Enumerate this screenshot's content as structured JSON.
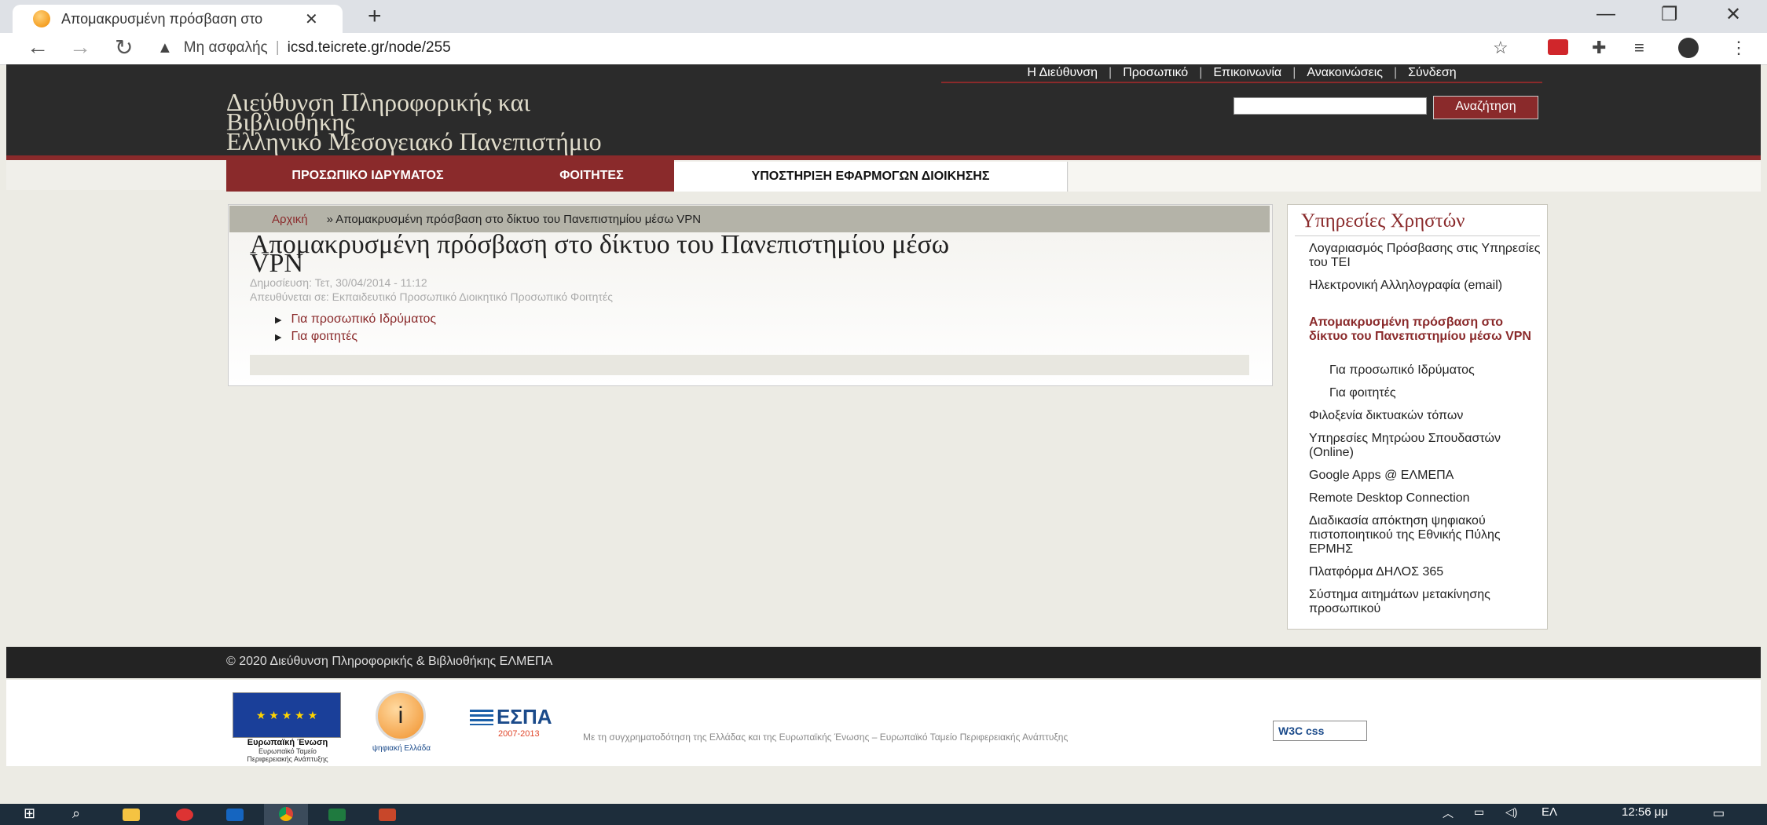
{
  "browser": {
    "tab_title": "Απομακρυσμένη πρόσβαση στο",
    "tab_close": "✕",
    "new_tab": "+",
    "not_secure": "Μη ασφαλής",
    "url": "icsd.teicrete.gr/node/255"
  },
  "site": {
    "title_lines": [
      "Διεύθυνση Πληροφορικής και",
      "Βιβλιοθήκης",
      "Ελληνικό Μεσογειακό Πανεπιστήμιο"
    ],
    "top_links": [
      "Η Διεύθυνση",
      "Προσωπικό",
      "Επικοινωνία",
      "Ανακοινώσεις",
      "Σύνδεση"
    ],
    "search_button": "Αναζήτηση",
    "nav": [
      "ΠΡΟΣΩΠΙΚΟ ΙΔΡΥΜΑΤΟΣ",
      "ΦΟΙΤΗΤΕΣ",
      "ΥΠΟΣΤΗΡΙΞΗ ΕΦΑΡΜΟΓΩΝ ΔΙΟΙΚΗΣΗΣ"
    ]
  },
  "main": {
    "breadcrumb_home": "Αρχική",
    "breadcrumb_current": "» Απομακρυσμένη πρόσβαση στο δίκτυο του Πανεπιστημίου μέσω VPN",
    "title_lines": [
      "Απομακρυσμένη πρόσβαση στο δίκτυο του Πανεπιστημίου μέσω",
      "VPN"
    ],
    "published": "Δημοσίευση: Τετ, 30/04/2014 - 11:12",
    "audience": "Απευθύνεται σε: Εκπαιδευτικό Προσωπικό Διοικητικό Προσωπικό Φοιτητές",
    "links": [
      "Για προσωπικό Ιδρύματος",
      "Για φοιτητές"
    ]
  },
  "sidebar": {
    "title": "Υπηρεσίες Χρηστών",
    "items": [
      "Λογαριασμός Πρόσβασης στις Υπηρεσίες του ΤΕΙ",
      "Ηλεκτρονική Αλληλογραφία (email)",
      "Απομακρυσμένη πρόσβαση στο δίκτυο του Πανεπιστημίου μέσω VPN",
      "Για προσωπικό Ιδρύματος",
      "Για φοιτητές",
      "Φιλοξενία δικτυακών τόπων",
      "Υπηρεσίες Μητρώου Σπουδαστών (Online)",
      "Google Apps @ ΕΛΜΕΠΑ",
      "Remote Desktop Connection",
      "Διαδικασία απόκτηση ψηφιακού πιστοποιητικού της Εθνικής Πύλης ΕΡΜΗΣ",
      "Πλατφόρμα ΔΗΛΟΣ 365",
      "Σύστημα αιτημάτων μετακίνησης προσωπικού"
    ]
  },
  "footer": {
    "copyright": "© 2020 Διεύθυνση Πληροφορικής & Βιβλιοθήκης ΕΛΜΕΠΑ",
    "eu_caption": [
      "Ευρωπαϊκή Ένωση",
      "Ευρωπαϊκό Ταμείο",
      "Περιφερειακής Ανάπτυξης"
    ],
    "psifiaki": "ψηφιακή Ελλάδα",
    "espa": "ΕΣΠΑ",
    "espa_years": "2007-2013",
    "funding": "Με τη συγχρηματοδότηση της Ελλάδας και της Ευρωπαϊκής Ένωσης – Ευρωπαϊκό Ταμείο Περιφερειακής Ανάπτυξης",
    "w3c": "W3C css"
  },
  "taskbar": {
    "lang": "ΕΛ",
    "time": "12:56 μμ"
  }
}
